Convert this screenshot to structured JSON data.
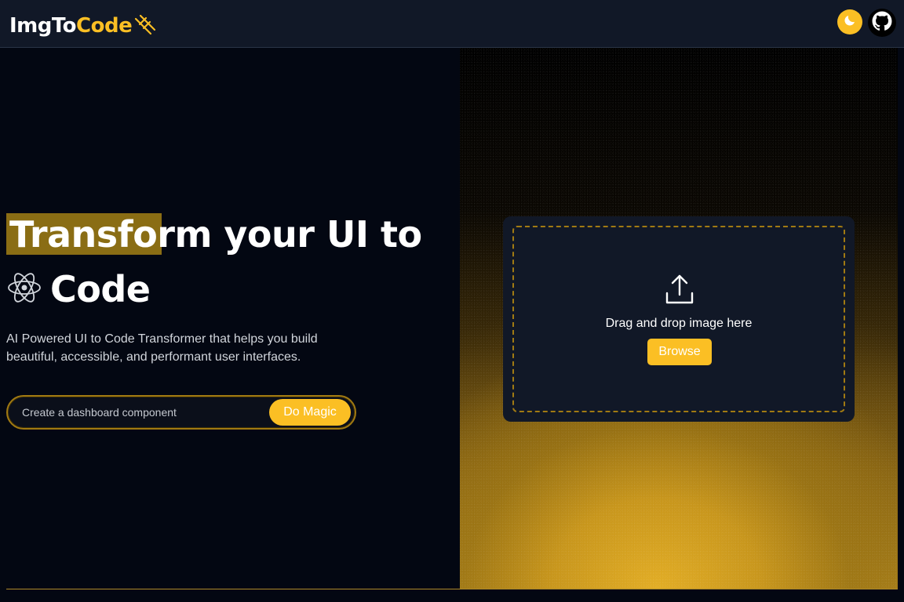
{
  "nav": {
    "logo_main": "ImgTo",
    "logo_accent": "Code",
    "theme_icon": "moon-icon",
    "github_icon": "github-icon"
  },
  "hero": {
    "headline_highlight": "Transform",
    "headline_rest": " your UI to",
    "headline_line2": "Code",
    "react_icon": "react-icon",
    "subtitle": "AI Powered UI to Code Transformer that helps you build beautiful, accessible, and performant user interfaces."
  },
  "prompt": {
    "placeholder": "Create a dashboard component",
    "button_label": "Do Magic"
  },
  "upload": {
    "icon": "upload-icon",
    "drop_text": "Drag and drop image here",
    "browse_label": "Browse"
  },
  "colors": {
    "accent": "#fbbf24",
    "background": "#030712",
    "navbar": "#111827"
  }
}
